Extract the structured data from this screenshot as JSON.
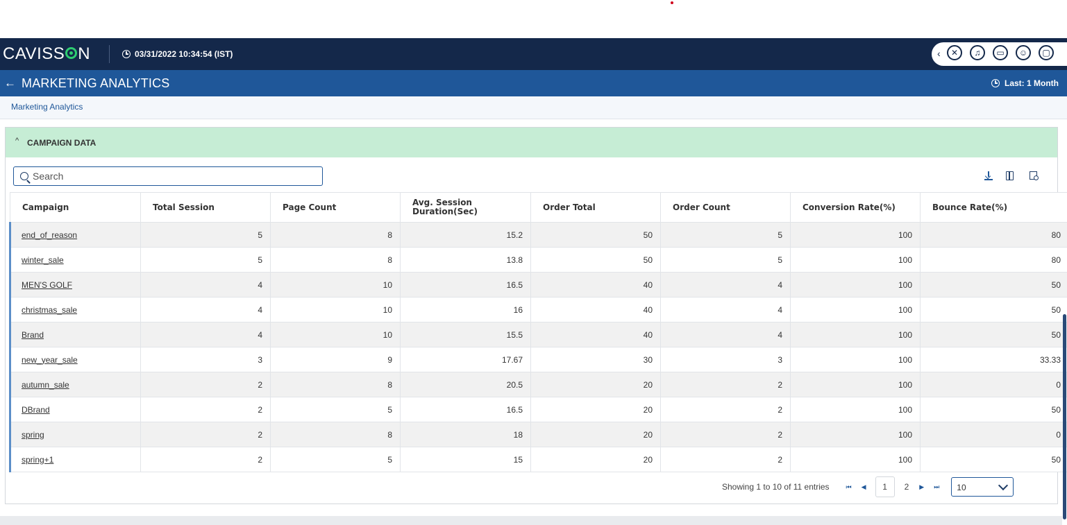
{
  "app": {
    "brand": "CAVISS",
    "brand_tail": "N",
    "datetime": "03/31/2022 10:34:54 (IST)"
  },
  "header_icons": [
    "chevron-left-icon",
    "tools-icon",
    "bell-icon",
    "monitor-icon",
    "user-icon",
    "display-icon"
  ],
  "title_bar": {
    "back_arrow": "←",
    "title": "MARKETING ANALYTICS",
    "time_range": "Last: 1 Month"
  },
  "breadcrumb": "Marketing Analytics",
  "panel": {
    "title": "CAMPAIGN DATA",
    "search_placeholder": "Search"
  },
  "table": {
    "columns": [
      "Campaign",
      "Total Session",
      "Page Count",
      "Avg. Session Duration(Sec)",
      "Order Total",
      "Order Count",
      "Conversion Rate(%)",
      "Bounce Rate(%)"
    ],
    "rows": [
      [
        "end_of_reason",
        "5",
        "8",
        "15.2",
        "50",
        "5",
        "100",
        "80"
      ],
      [
        "winter_sale",
        "5",
        "8",
        "13.8",
        "50",
        "5",
        "100",
        "80"
      ],
      [
        "MEN'S GOLF",
        "4",
        "10",
        "16.5",
        "40",
        "4",
        "100",
        "50"
      ],
      [
        "christmas_sale",
        "4",
        "10",
        "16",
        "40",
        "4",
        "100",
        "50"
      ],
      [
        "Brand",
        "4",
        "10",
        "15.5",
        "40",
        "4",
        "100",
        "50"
      ],
      [
        "new_year_sale",
        "3",
        "9",
        "17.67",
        "30",
        "3",
        "100",
        "33.33"
      ],
      [
        "autumn_sale",
        "2",
        "8",
        "20.5",
        "20",
        "2",
        "100",
        "0"
      ],
      [
        "DBrand",
        "2",
        "5",
        "16.5",
        "20",
        "2",
        "100",
        "50"
      ],
      [
        "spring",
        "2",
        "8",
        "18",
        "20",
        "2",
        "100",
        "0"
      ],
      [
        "spring+1",
        "2",
        "5",
        "15",
        "20",
        "2",
        "100",
        "50"
      ]
    ]
  },
  "pagination": {
    "info": "Showing 1 to 10 of 11 entries",
    "pages": [
      "1",
      "2"
    ],
    "current_page": "1",
    "page_size": "10"
  },
  "colors": {
    "topbar": "#14284a",
    "titlebar": "#1f5799",
    "panel_header": "#c6edd5",
    "row_accent": "#5b8ec8"
  }
}
